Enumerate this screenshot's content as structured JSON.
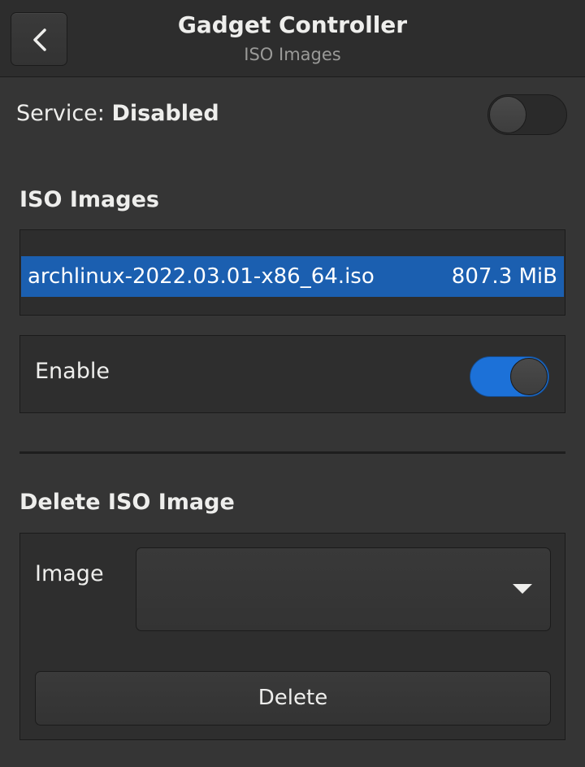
{
  "header": {
    "title": "Gadget Controller",
    "subtitle": "ISO Images",
    "back_icon": "chevron-left-icon"
  },
  "service": {
    "label": "Service: ",
    "status": "Disabled",
    "switch_on": false
  },
  "iso_images": {
    "section_title": "ISO Images",
    "items": [
      {
        "name": "archlinux-2022.03.01-x86_64.iso",
        "size": "807.3 MiB",
        "selected": true
      }
    ],
    "enable_label": "Enable",
    "enable_on": true
  },
  "delete_iso": {
    "section_title": "Delete ISO Image",
    "image_label": "Image",
    "image_value": "",
    "delete_label": "Delete"
  },
  "colors": {
    "accent": "#1c71d8",
    "selection": "#1b5fb0",
    "background": "#353535"
  }
}
